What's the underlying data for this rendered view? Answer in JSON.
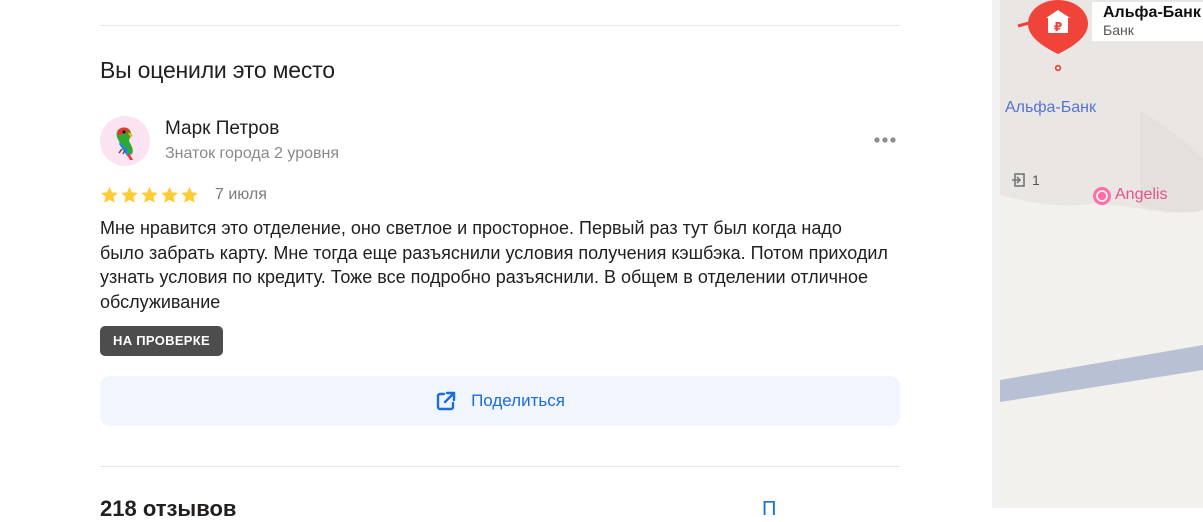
{
  "section_title": "Вы оценили это место",
  "review": {
    "author_name": "Марк Петров",
    "author_level": "Знаток города 2 уровня",
    "rating": 5,
    "date": "7 июля",
    "text": "Мне нравится это отделение, оно светлое и просторное. Первый раз тут был когда надо было забрать карту. Мне тогда еще разъяснили условия получения кэшбэка. Потом приходил узнать условия по кредиту. Тоже все подробно разъяснили. В общем в отделении отличное обслуживание",
    "status_badge": "НА ПРОВЕРКЕ"
  },
  "share_label": "Поделиться",
  "reviews_count_label": "218 отзывов",
  "reviews_link_partial": "П",
  "colors": {
    "accent": "#1a6ddc",
    "star": "#fc3",
    "marker": "#f0433a",
    "badge_bg": "#4d4d4d"
  },
  "map": {
    "marker_title": "Альфа-Банк",
    "marker_subtitle": "Банк",
    "poi_label": "Альфа-Банк",
    "entrance_number": "1",
    "shop_label": "Angelis",
    "marker_icon": "bank-ruble-icon"
  }
}
